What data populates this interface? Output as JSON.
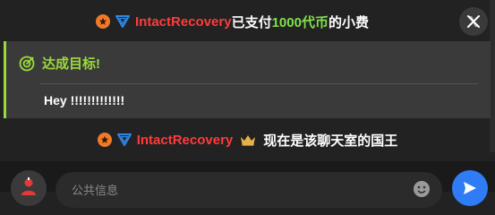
{
  "notice_top": {
    "username": "IntactRecovery",
    "text_before_amount": "已支付",
    "amount": "1000代币",
    "text_after_amount": "的小费"
  },
  "goal": {
    "title": "达成目标!",
    "message": "Hey !!!!!!!!!!!!!"
  },
  "notice_bottom": {
    "username": "IntactRecovery",
    "text": "现在是该聊天室的国王"
  },
  "composer": {
    "placeholder": "公共信息"
  },
  "colors": {
    "username": "#ff3b3b",
    "amount": "#7fe04a",
    "goal_accent": "#9adb3a",
    "send_button": "#2f7cf6",
    "badge_orange": "#f07a2a",
    "badge_blue": "#2f86e6",
    "crown": "#e8b04a"
  },
  "icons": {
    "close": "x-logo-icon",
    "goal": "target-icon",
    "badge_star": "star-badge-icon",
    "badge_chevron": "chevron-badge-icon",
    "crown": "crown-icon",
    "emoji": "emoji-icon",
    "send": "send-icon",
    "avatar": "avatar-icon"
  }
}
